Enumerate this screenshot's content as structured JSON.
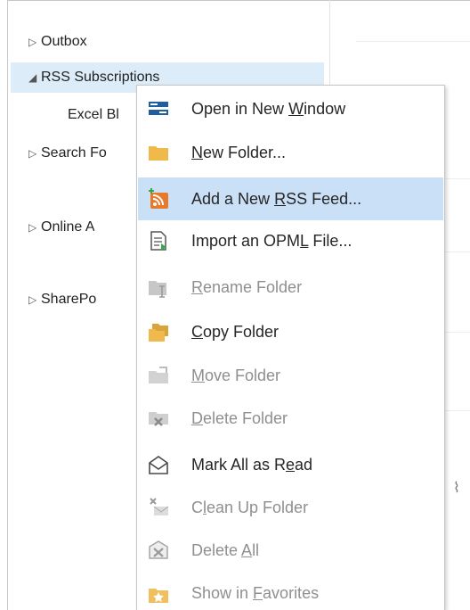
{
  "folders": {
    "outbox": "Outbox",
    "rss": "RSS Subscriptions",
    "excel": "Excel Bl",
    "search": "Search Fo",
    "online": "Online A",
    "sharepoint": "SharePo"
  },
  "menu": [
    {
      "id": "open-new-window",
      "pre": "Open in New ",
      "u": "W",
      "post": "indow",
      "disabled": false,
      "highlight": false,
      "icon": "new-window-icon"
    },
    {
      "id": "new-folder",
      "pre": "",
      "u": "N",
      "post": "ew Folder...",
      "disabled": false,
      "highlight": false,
      "icon": "folder-icon"
    },
    {
      "id": "add-rss-feed",
      "pre": "Add a New ",
      "u": "R",
      "post": "SS Feed...",
      "disabled": false,
      "highlight": true,
      "icon": "rss-add-icon"
    },
    {
      "id": "import-opml",
      "pre": "Import an OPM",
      "u": "L",
      "post": " File...",
      "disabled": false,
      "highlight": false,
      "icon": "import-file-icon"
    },
    {
      "id": "rename-folder",
      "pre": "",
      "u": "R",
      "post": "ename Folder",
      "disabled": true,
      "highlight": false,
      "icon": "rename-folder-icon"
    },
    {
      "id": "copy-folder",
      "pre": "",
      "u": "C",
      "post": "opy Folder",
      "disabled": false,
      "highlight": false,
      "icon": "copy-folder-icon"
    },
    {
      "id": "move-folder",
      "pre": "",
      "u": "M",
      "post": "ove Folder",
      "disabled": true,
      "highlight": false,
      "icon": "move-folder-icon"
    },
    {
      "id": "delete-folder",
      "pre": "",
      "u": "D",
      "post": "elete Folder",
      "disabled": true,
      "highlight": false,
      "icon": "delete-folder-icon"
    },
    {
      "id": "mark-all-read",
      "pre": "Mark All as R",
      "u": "e",
      "post": "ad",
      "disabled": false,
      "highlight": false,
      "icon": "open-envelope-icon"
    },
    {
      "id": "clean-up-folder",
      "pre": "C",
      "u": "l",
      "post": "ean Up Folder",
      "disabled": true,
      "highlight": false,
      "icon": "clean-up-icon"
    },
    {
      "id": "delete-all",
      "pre": "Delete ",
      "u": "A",
      "post": "ll",
      "disabled": true,
      "highlight": false,
      "icon": "delete-all-icon"
    },
    {
      "id": "show-in-favorites",
      "pre": "Show in ",
      "u": "F",
      "post": "avorites",
      "disabled": true,
      "highlight": false,
      "icon": "star-folder-icon"
    }
  ]
}
